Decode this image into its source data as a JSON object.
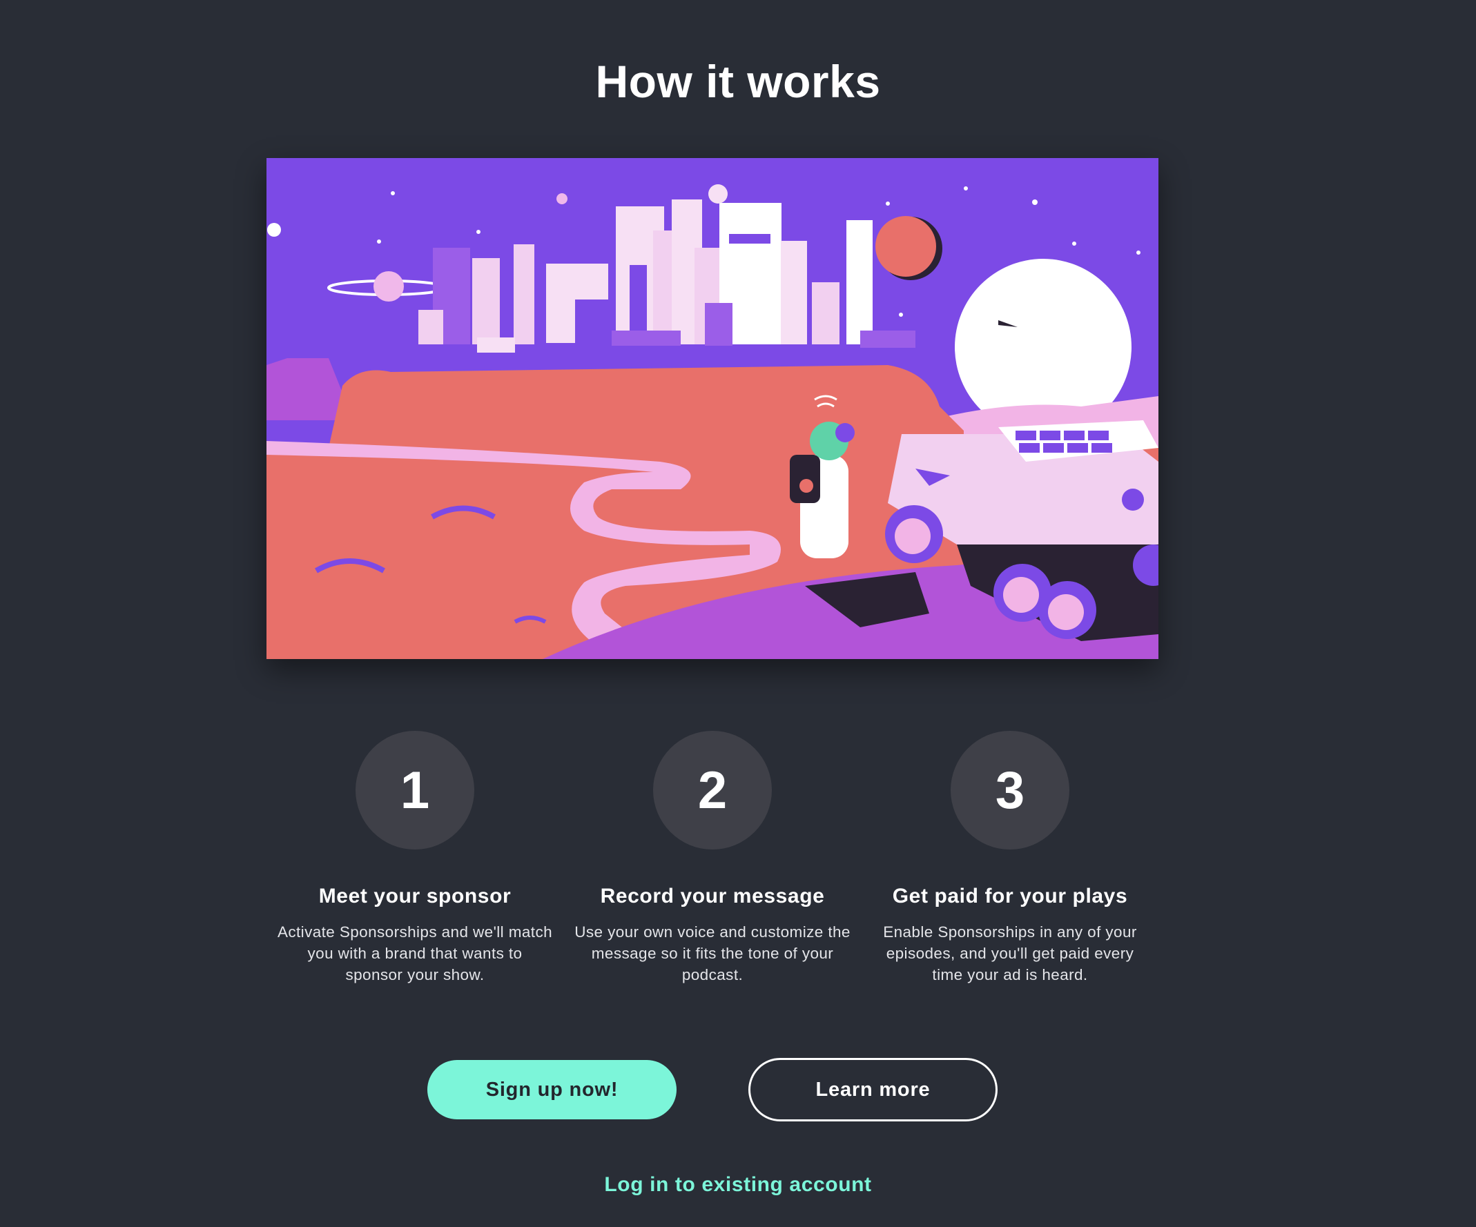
{
  "page": {
    "title": "How it works"
  },
  "colors": {
    "background": "#292d36",
    "accent": "#7cf5d9",
    "step_circle": "#3f4048",
    "hero_sky": "#7c4ae6",
    "hero_ground": "#e8706a"
  },
  "hero": {
    "icon": "mars-city-illustration"
  },
  "steps": [
    {
      "number": "1",
      "title": "Meet your sponsor",
      "description": "Activate Sponsorships and we'll match you with a brand that wants to sponsor your show."
    },
    {
      "number": "2",
      "title": "Record your message",
      "description": "Use your own voice and customize the message so it fits the tone of your podcast."
    },
    {
      "number": "3",
      "title": "Get paid for your plays",
      "description": "Enable Sponsorships in any of your episodes, and you'll get paid every time your ad is heard."
    }
  ],
  "actions": {
    "signup_label": "Sign up now!",
    "learn_more_label": "Learn more",
    "login_label": "Log in to existing account"
  }
}
